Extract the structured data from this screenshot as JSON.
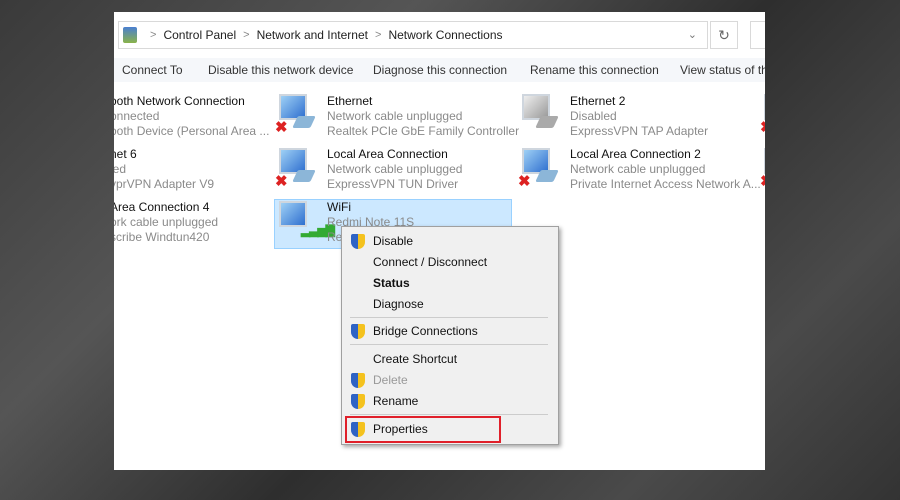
{
  "address": {
    "crumbs": [
      "Control Panel",
      "Network and Internet",
      "Network Connections"
    ]
  },
  "toolbar": [
    "Connect To",
    "Disable this network device",
    "Diagnose this connection",
    "Rename this connection",
    "View status of this connection"
  ],
  "connections": [
    {
      "name": "ooth Network Connection",
      "status": "onnected",
      "device": "ooth Device (Personal Area ..."
    },
    {
      "name": "Ethernet",
      "status": "Network cable unplugged",
      "device": "Realtek PCIe GbE Family Controller"
    },
    {
      "name": "Ethernet 2",
      "status": "Disabled",
      "device": "ExpressVPN TAP Adapter"
    },
    {
      "name": "net 6",
      "status": "led",
      "device": "yprVPN Adapter V9"
    },
    {
      "name": "Local Area Connection",
      "status": "Network cable unplugged",
      "device": "ExpressVPN TUN Driver"
    },
    {
      "name": "Local Area Connection 2",
      "status": "Network cable unplugged",
      "device": "Private Internet Access Network A..."
    },
    {
      "name": "Area Connection 4",
      "status": "ork cable unplugged",
      "device": "scribe Windtun420"
    },
    {
      "name": "WiFi",
      "status": "Redmi Note 11S",
      "device": "Re"
    }
  ],
  "menu": [
    {
      "label": "Disable"
    },
    {
      "label": "Connect / Disconnect"
    },
    {
      "label": "Status"
    },
    {
      "label": "Diagnose"
    },
    {
      "label": "Bridge Connections"
    },
    {
      "label": "Create Shortcut"
    },
    {
      "label": "Delete"
    },
    {
      "label": "Rename"
    },
    {
      "label": "Properties"
    }
  ],
  "colors": {
    "highlight": "#e0202a",
    "selection": "#cce8ff"
  }
}
